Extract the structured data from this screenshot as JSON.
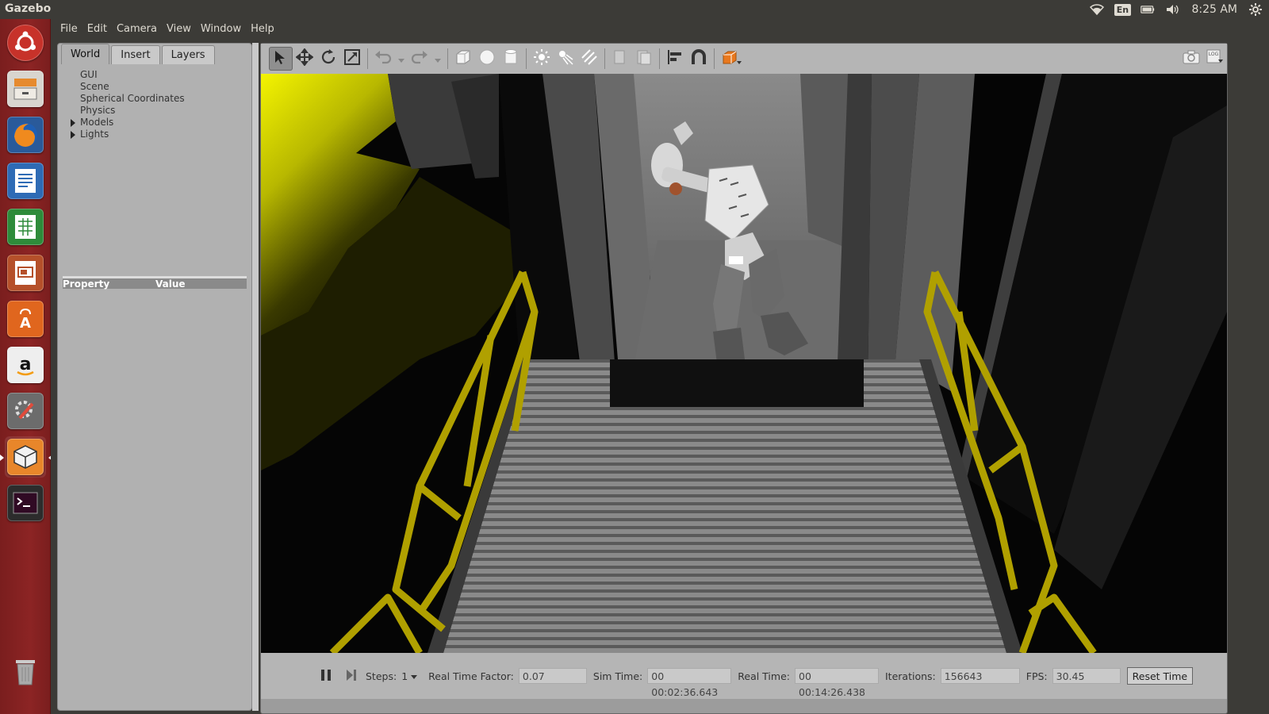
{
  "system": {
    "app_title": "Gazebo",
    "keyboard_layout": "En",
    "clock": "8:25 AM"
  },
  "launcher": {
    "items": [
      "ubuntu-dash",
      "files",
      "firefox",
      "writer",
      "calc",
      "impress",
      "software-center",
      "amazon",
      "system-settings",
      "gazebo",
      "terminal",
      "trash"
    ]
  },
  "menu": {
    "items": [
      "File",
      "Edit",
      "Camera",
      "View",
      "Window",
      "Help"
    ]
  },
  "left_panel": {
    "tabs": [
      "World",
      "Insert",
      "Layers"
    ],
    "active_tab": "World",
    "tree": [
      {
        "label": "GUI",
        "expandable": false
      },
      {
        "label": "Scene",
        "expandable": false
      },
      {
        "label": "Spherical Coordinates",
        "expandable": false
      },
      {
        "label": "Physics",
        "expandable": false
      },
      {
        "label": "Models",
        "expandable": true
      },
      {
        "label": "Lights",
        "expandable": true
      }
    ],
    "property_header": {
      "property": "Property",
      "value": "Value"
    }
  },
  "toolbar": {
    "tools": [
      "select-arrow",
      "translate",
      "rotate",
      "scale",
      "undo",
      "undo-dropdown",
      "redo",
      "redo-dropdown",
      "box",
      "sphere",
      "cylinder",
      "point-light",
      "spot-light",
      "directional-light",
      "copy",
      "paste",
      "align",
      "snap",
      "view-angle"
    ],
    "right_tools": [
      "screenshot",
      "log"
    ]
  },
  "bottom_bar": {
    "steps_label": "Steps:",
    "steps_value": "1",
    "rtf_label": "Real Time Factor:",
    "rtf_value": "0.07",
    "sim_time_label": "Sim Time:",
    "sim_time_value": "00 00:02:36.643",
    "real_time_label": "Real Time:",
    "real_time_value": "00 00:14:26.438",
    "iterations_label": "Iterations:",
    "iterations_value": "156643",
    "fps_label": "FPS:",
    "fps_value": "30.45",
    "reset_label": "Reset Time"
  },
  "colors": {
    "launcher_bg": "#8c2424",
    "panel_bg": "#b1b1b1",
    "rail_yellow": "#b8a400",
    "highlight_yellow": "#f0f000"
  }
}
